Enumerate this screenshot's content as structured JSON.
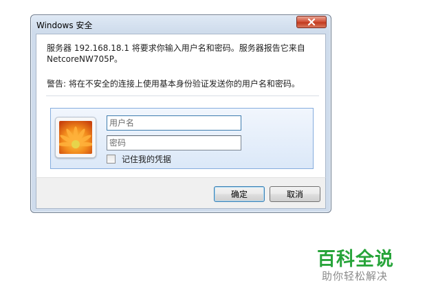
{
  "window": {
    "title": "Windows 安全",
    "close_icon": "close-icon"
  },
  "message": {
    "line1": "服务器 192.168.18.1 将要求你输入用户名和密码。服务器报告它来自 NetcoreNW705P。",
    "warning": "警告: 将在不安全的连接上使用基本身份验证发送你的用户名和密码。"
  },
  "credentials": {
    "user_icon": "user-picture-flower-icon",
    "username_placeholder": "用户名",
    "username_value": "",
    "password_placeholder": "密码",
    "password_value": "",
    "remember_label": "记住我的凭据",
    "remember_checked": false
  },
  "buttons": {
    "ok_label": "确定",
    "cancel_label": "取消"
  },
  "watermark": {
    "title": "百科全说",
    "subtitle": "助你轻松解决"
  },
  "colors": {
    "close_button": "#c94a30",
    "panel_border": "#84acdd",
    "watermark_green": "#27a43a"
  }
}
